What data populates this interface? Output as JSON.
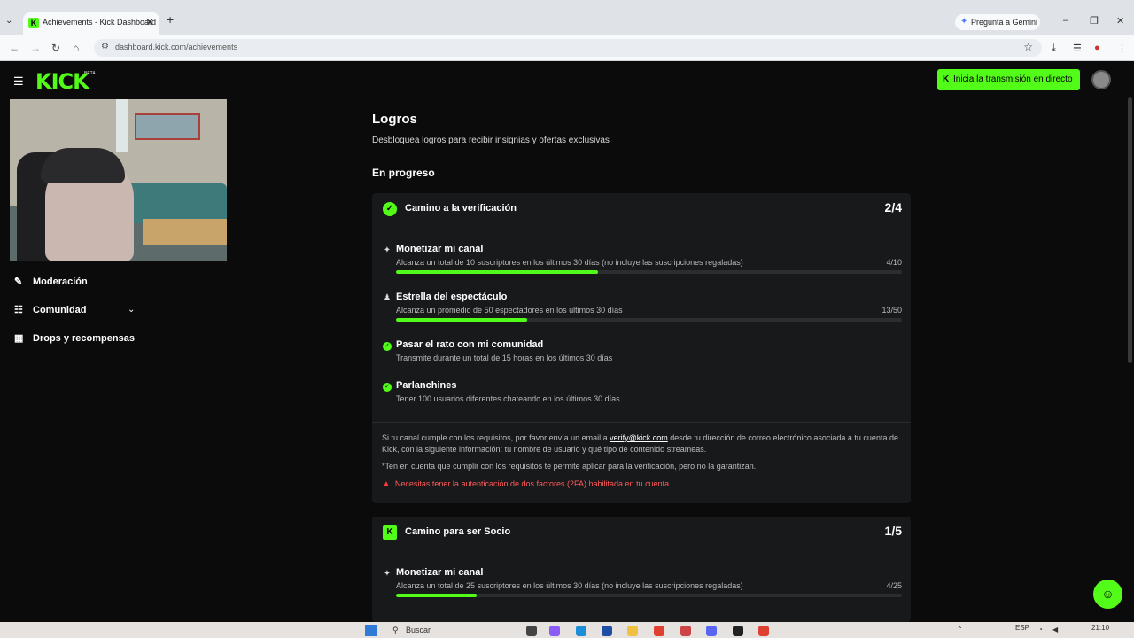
{
  "browser": {
    "tab_title": "Achievements - Kick Dashboard",
    "tab_favicon": "K",
    "gemini_label": "Pregunta a Gemini",
    "url": "dashboard.kick.com/achievements"
  },
  "header": {
    "logo": "KICK",
    "logo_badge": "BETA",
    "golive_label": "Inicia la transmisión en directo"
  },
  "sidebar": {
    "items": [
      {
        "label": "Moderación",
        "icon": "wrench-icon"
      },
      {
        "label": "Comunidad",
        "icon": "community-icon"
      },
      {
        "label": "Drops y recompensas",
        "icon": "gift-icon"
      }
    ]
  },
  "main": {
    "title": "Logros",
    "subtitle": "Desbloquea logros para recibir insignias y ofertas exclusivas",
    "section": "En progreso",
    "card1": {
      "title": "Camino a la verificación",
      "count": "2/4",
      "tasks": [
        {
          "title": "Monetizar mi canal",
          "desc": "Alcanza un total de 10 suscriptores en los últimos 30 días (no incluye las suscripciones regaladas)",
          "progress": "4/10",
          "fill": 0.4
        },
        {
          "title": "Estrella del espectáculo",
          "desc": "Alcanza un promedio de 50 espectadores en los últimos 30 días",
          "progress": "13/50",
          "fill": 0.26
        },
        {
          "title": "Pasar el rato con mi comunidad",
          "desc": "Transmite durante un total de 15 horas en los últimos 30 días"
        },
        {
          "title": "Parlanchines",
          "desc": "Tener 100 usuarios diferentes chateando en los últimos 30 días"
        }
      ],
      "note1_a": "Si tu canal cumple con los requisitos, por favor envía un email a ",
      "note1_link": "verify@kick.com",
      "note1_b": " desde tu dirección de correo electrónico asociada a tu cuenta de Kick, con la siguiente información: tu nombre de usuario y qué tipo de contenido streameas.",
      "note2": "*Ten en cuenta que cumplir con los requisitos te permite aplicar para la verificación, pero no la garantizan.",
      "warning": "Necesitas tener la autenticación de dos factores (2FA) habilitada en tu cuenta"
    },
    "card2": {
      "title": "Camino para ser Socio",
      "count": "1/5",
      "tasks": [
        {
          "title": "Monetizar mi canal",
          "desc": "Alcanza un total de 25 suscriptores en los últimos 30 días (no incluye las suscripciones regaladas)",
          "progress": "4/25",
          "fill": 0.16
        }
      ]
    }
  },
  "taskbar": {
    "search_label": "Buscar",
    "lang": "ESP",
    "time": "21:10"
  },
  "colors": {
    "accent": "#53fc18",
    "card_bg": "#18191b",
    "warning": "#ff5a5a"
  }
}
